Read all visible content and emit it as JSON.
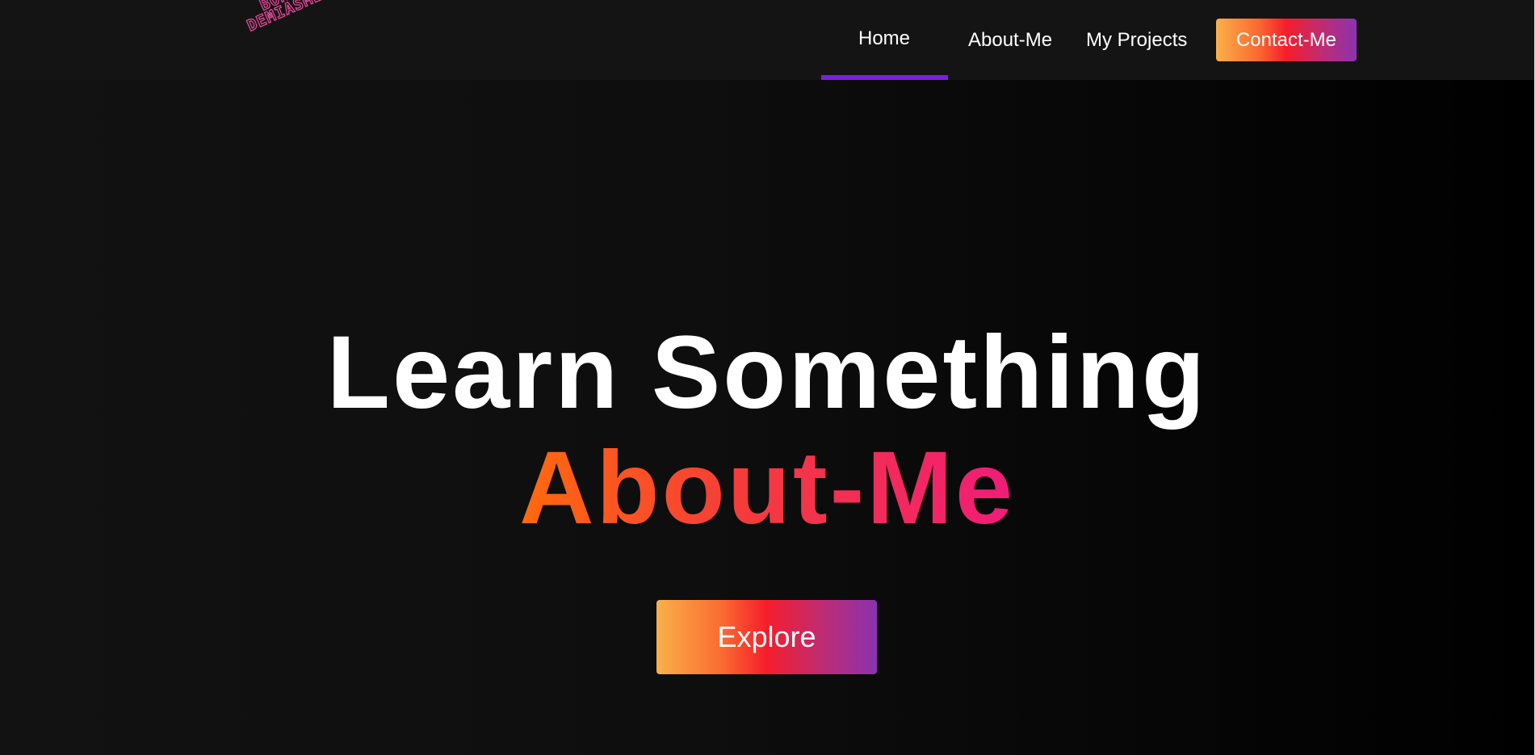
{
  "logo": {
    "line1": "Bonis",
    "line2": "Demiasmen"
  },
  "nav": {
    "items": [
      {
        "label": "Home",
        "active": true
      },
      {
        "label": "About-Me",
        "active": false
      },
      {
        "label": "My Projects",
        "active": false
      }
    ],
    "contact_label": "Contact-Me"
  },
  "hero": {
    "line1": "Learn Something",
    "line2": "About-Me",
    "button_label": "Explore"
  },
  "colors": {
    "page_background": "#0c0c0c",
    "navbar_background": "#141414",
    "active_underline": "#7a1fe0",
    "logo_stroke": "#e44a9a",
    "button_gradient": [
      "#fbb04a",
      "#f51d2b",
      "#8a33b0"
    ],
    "hero_gradient": [
      "#ff6a0d",
      "#f01c79"
    ],
    "text": "#ffffff"
  }
}
